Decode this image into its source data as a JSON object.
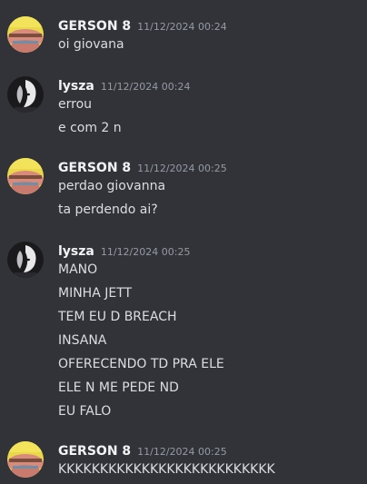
{
  "colors": {
    "background": "#313338",
    "username": "#f2f3f5",
    "timestamp": "#949ba4",
    "message_text": "#dbdee1"
  },
  "messages": [
    {
      "author": "GERSON 8",
      "avatar_icon": "gerson-avatar-icon",
      "timestamp": "11/12/2024 00:24",
      "lines": [
        "oi giovana"
      ]
    },
    {
      "author": "lysza",
      "avatar_icon": "lysza-avatar-icon",
      "timestamp": "11/12/2024 00:24",
      "lines": [
        "errou",
        "e com 2 n"
      ]
    },
    {
      "author": "GERSON 8",
      "avatar_icon": "gerson-avatar-icon",
      "timestamp": "11/12/2024 00:25",
      "lines": [
        "perdao giovanna",
        "ta perdendo ai?"
      ]
    },
    {
      "author": "lysza",
      "avatar_icon": "lysza-avatar-icon",
      "timestamp": "11/12/2024 00:25",
      "lines": [
        "MANO",
        "MINHA JETT",
        "TEM EU D BREACH",
        "INSANA",
        "OFERECENDO TD PRA ELE",
        "ELE N ME PEDE ND",
        "EU FALO"
      ]
    },
    {
      "author": "GERSON 8",
      "avatar_icon": "gerson-avatar-icon",
      "timestamp": "11/12/2024 00:25",
      "lines": [
        "KKKKKKKKKKKKKKKKKKKKKKKKKK"
      ]
    }
  ]
}
